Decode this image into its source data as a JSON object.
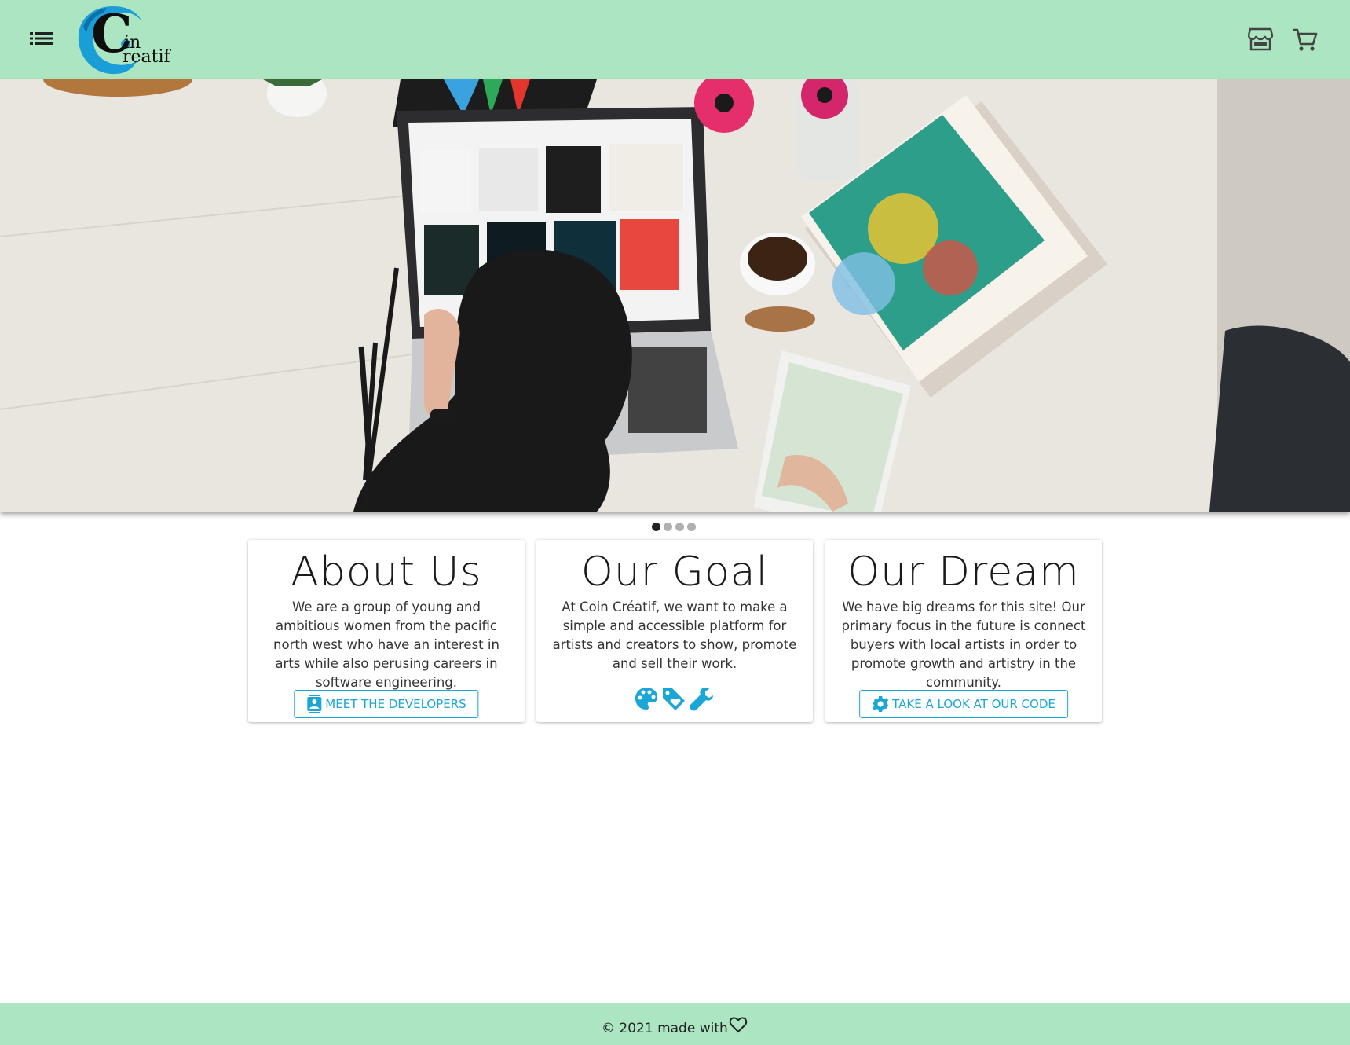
{
  "header": {
    "logo_c": "C",
    "logo_in": "in",
    "logo_reatif": "reatif",
    "icons": [
      "list-icon",
      "store-icon",
      "cart-icon"
    ]
  },
  "carousel": {
    "slides": 4,
    "active_index": 0
  },
  "cards": [
    {
      "title": "About Us",
      "text": "We are a group of young and ambitious women from the pacific north west who have an interest in arts while also perusing careers in software engineering.",
      "button": "MEET THE DEVELOPERS",
      "button_icon": "contacts-icon"
    },
    {
      "title": "Our Goal",
      "text": "At Coin Créatif, we want to make a simple and accessible platform for artists and creators to show, promote and sell their work.",
      "icons": [
        "palette-icon",
        "tag-icon",
        "wrench-icon"
      ]
    },
    {
      "title": "Our Dream",
      "text": "We have big dreams for this site! Our primary focus in the future is connect buyers with local artists in order to promote growth and artistry in the community.",
      "button": "TAKE A LOOK AT OUR CODE",
      "button_icon": "gear-icon"
    }
  ],
  "footer": {
    "text": "© 2021 made with",
    "icon": "heart-icon"
  },
  "colors": {
    "header_bg": "#ace5c1",
    "accent": "#1aa6d6",
    "footer_bg": "#ace5c1"
  }
}
